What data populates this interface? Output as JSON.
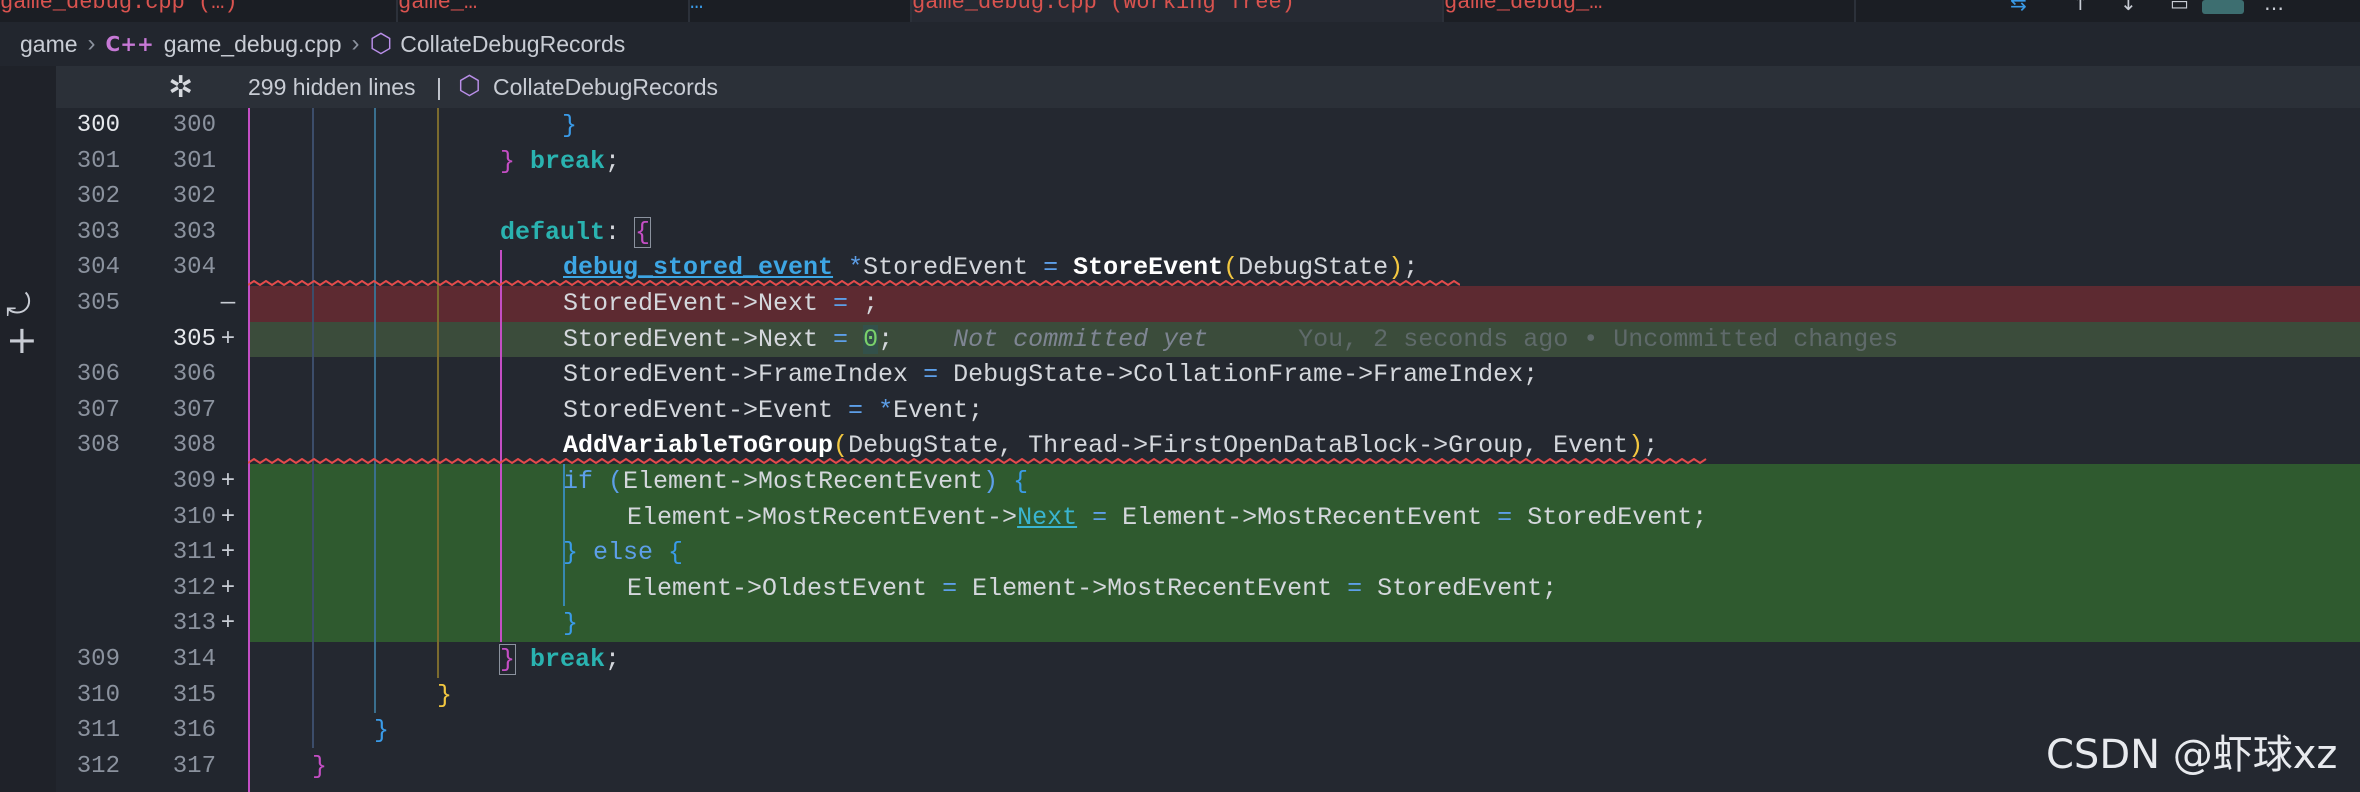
{
  "tabs": [
    {
      "label": "game_debug.cpp (…)",
      "active": false
    },
    {
      "label": "game_…",
      "active": false
    },
    {
      "label": "…",
      "active": false
    },
    {
      "label": "game_debug.cpp (Working Tree)",
      "active": true
    },
    {
      "label": "game_debug_…",
      "active": false
    }
  ],
  "breadcrumb": {
    "folder": "game",
    "file_icon": "C++",
    "file": "game_debug.cpp",
    "symbol": "CollateDebugRecords"
  },
  "sticky": {
    "fold_icon": "✲",
    "hidden_lines": "299 hidden lines",
    "separator": "|",
    "symbol": "CollateDebugRecords"
  },
  "activity": {
    "revert_icon": "⤾",
    "add_icon": "+"
  },
  "lines": [
    {
      "ln1": "300",
      "ln2": "300",
      "mark": "",
      "type": "normal",
      "current": true
    },
    {
      "ln1": "301",
      "ln2": "301",
      "mark": "",
      "type": "normal"
    },
    {
      "ln1": "302",
      "ln2": "302",
      "mark": "",
      "type": "normal"
    },
    {
      "ln1": "303",
      "ln2": "303",
      "mark": "",
      "type": "normal"
    },
    {
      "ln1": "304",
      "ln2": "304",
      "mark": "",
      "type": "normal"
    },
    {
      "ln1": "305",
      "ln2": "",
      "mark": "—",
      "type": "del"
    },
    {
      "ln1": "",
      "ln2": "305",
      "mark": "+",
      "type": "blame",
      "current2": true
    },
    {
      "ln1": "306",
      "ln2": "306",
      "mark": "",
      "type": "normal"
    },
    {
      "ln1": "307",
      "ln2": "307",
      "mark": "",
      "type": "normal"
    },
    {
      "ln1": "308",
      "ln2": "308",
      "mark": "",
      "type": "normal"
    },
    {
      "ln1": "",
      "ln2": "309",
      "mark": "+",
      "type": "add"
    },
    {
      "ln1": "",
      "ln2": "310",
      "mark": "+",
      "type": "add"
    },
    {
      "ln1": "",
      "ln2": "311",
      "mark": "+",
      "type": "add"
    },
    {
      "ln1": "",
      "ln2": "312",
      "mark": "+",
      "type": "add"
    },
    {
      "ln1": "",
      "ln2": "313",
      "mark": "+",
      "type": "add"
    },
    {
      "ln1": "309",
      "ln2": "314",
      "mark": "",
      "type": "normal"
    },
    {
      "ln1": "310",
      "ln2": "315",
      "mark": "",
      "type": "normal"
    },
    {
      "ln1": "311",
      "ln2": "316",
      "mark": "",
      "type": "normal"
    },
    {
      "ln1": "312",
      "ln2": "317",
      "mark": "",
      "type": "normal"
    }
  ],
  "code": {
    "l300_close": "}",
    "l301_close": "}",
    "l301_break": "break",
    "l301_semi": ";",
    "l303_default": "default",
    "l303_colon": ": ",
    "l303_open": "{",
    "l304_type": "debug_stored_event",
    "l304_star": " *",
    "l304_var": "StoredEvent",
    "l304_eq": " = ",
    "l304_fn": "StoreEvent",
    "l304_po": "(",
    "l304_arg": "DebugState",
    "l304_pc": ")",
    "l304_semi": ";",
    "l305d_a": "StoredEvent->Next",
    "l305d_eq": " = ",
    "l305d_semi": ";",
    "l305_a": "StoredEvent->Next",
    "l305_eq": " = ",
    "l305_num": "0",
    "l305_semi": ";",
    "l305_blame1": "Not committed yet",
    "l305_blame2": "You, 2 seconds ago • Uncommitted changes",
    "l306_a": "StoredEvent->FrameIndex",
    "l306_eq": " = ",
    "l306_b": "DebugState->CollationFrame->FrameIndex;",
    "l307_a": "StoredEvent->Event",
    "l307_eq": " = ",
    "l307_star": "*",
    "l307_b": "Event;",
    "l308_fn": "AddVariableToGroup",
    "l308_po": "(",
    "l308_args": "DebugState, Thread->FirstOpenDataBlock->Group, Event",
    "l308_pc": ")",
    "l308_semi": ";",
    "l309_if": "if",
    "l309_po": " (",
    "l309_cond": "Element->MostRecentEvent",
    "l309_pc": ")",
    "l309_ob": " {",
    "l310_a": "Element->MostRecentEvent->",
    "l310_link": "Next",
    "l310_eq": " = ",
    "l310_b": "Element->MostRecentEvent",
    "l310_eq2": " = ",
    "l310_c": "StoredEvent;",
    "l311_cb": "} ",
    "l311_else": "else",
    "l311_ob": " {",
    "l312_a": "Element->OldestEvent",
    "l312_eq": " = ",
    "l312_b": "Element->MostRecentEvent",
    "l312_eq2": " = ",
    "l312_c": "StoredEvent;",
    "l313_cb": "}",
    "l314_close": "}",
    "l314_break": "break",
    "l314_semi": ";",
    "l315_close": "}",
    "l316_close": "}",
    "l317_close": "}"
  },
  "watermark": "CSDN @虾球xz",
  "colors": {
    "background": "#22262e",
    "deleted_line": "#5d2a31",
    "added_line": "#2f5a2f",
    "keyword": "#2ab3b0",
    "type": "#3da6e4"
  }
}
